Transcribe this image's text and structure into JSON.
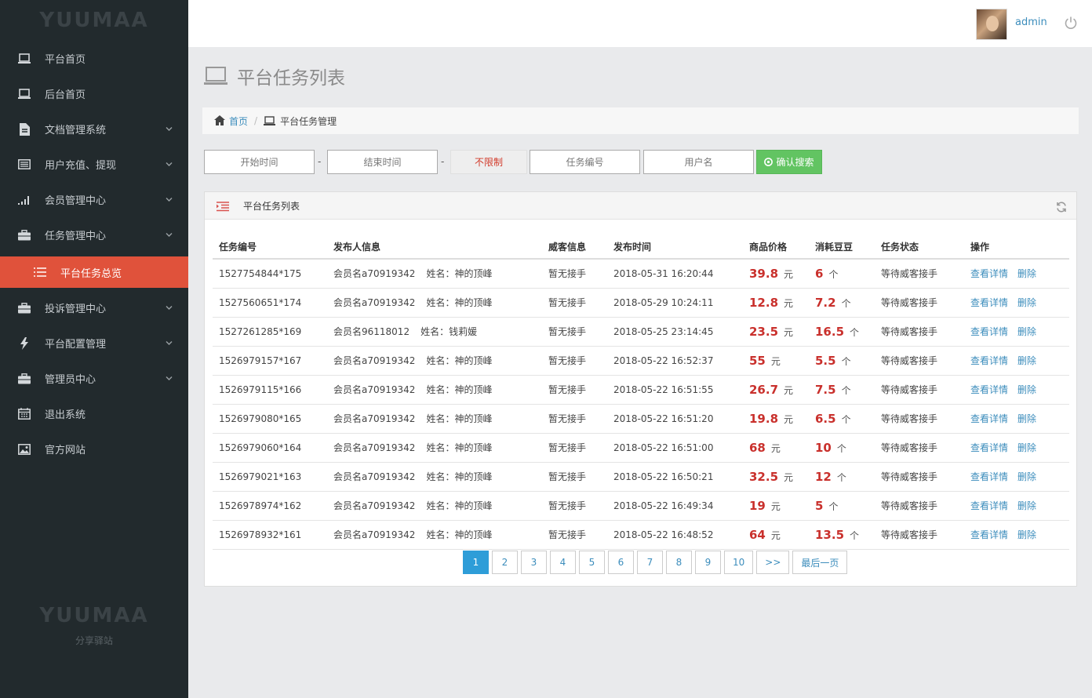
{
  "sidebar": {
    "logo": "YUUMAA",
    "items": [
      {
        "label": "平台首页"
      },
      {
        "label": "后台首页"
      },
      {
        "label": "文档管理系统"
      },
      {
        "label": "用户充值、提现"
      },
      {
        "label": "会员管理中心"
      },
      {
        "label": "任务管理中心"
      },
      {
        "label": "平台任务总览"
      },
      {
        "label": "投诉管理中心"
      },
      {
        "label": "平台配置管理"
      },
      {
        "label": "管理员中心"
      },
      {
        "label": "退出系统"
      },
      {
        "label": "官方网站"
      }
    ],
    "footer_logo": "YUUMAA",
    "footer_sub": "分享驿站"
  },
  "topbar": {
    "username": "admin"
  },
  "page": {
    "title": "平台任务列表"
  },
  "breadcrumb": {
    "home": "首页",
    "current": "平台任务管理"
  },
  "filters": {
    "start_placeholder": "开始时间",
    "end_placeholder": "结束时间",
    "dash": "-",
    "limit": "不限制",
    "task_no_placeholder": "任务编号",
    "username_placeholder": "用户名",
    "search_label": "确认搜索"
  },
  "panel": {
    "title": "平台任务列表"
  },
  "table": {
    "headers": [
      "任务编号",
      "发布人信息",
      "威客信息",
      "发布时间",
      "商品价格",
      "消耗豆豆",
      "任务状态",
      "操作"
    ],
    "price_unit": "元",
    "beans_unit": "个",
    "view_label": "查看详情",
    "delete_label": "删除",
    "rows": [
      {
        "id": "1527754844*175",
        "member": "会员名a70919342",
        "name": "姓名：神的顶峰",
        "worker": "暂无接手",
        "time": "2018-05-31 16:20:44",
        "price": "39.8",
        "beans": "6",
        "status": "等待威客接手"
      },
      {
        "id": "1527560651*174",
        "member": "会员名a70919342",
        "name": "姓名：神的顶峰",
        "worker": "暂无接手",
        "time": "2018-05-29 10:24:11",
        "price": "12.8",
        "beans": "7.2",
        "status": "等待威客接手"
      },
      {
        "id": "1527261285*169",
        "member": "会员名96118012",
        "name": "姓名：钱莉媛",
        "worker": "暂无接手",
        "time": "2018-05-25 23:14:45",
        "price": "23.5",
        "beans": "16.5",
        "status": "等待威客接手"
      },
      {
        "id": "1526979157*167",
        "member": "会员名a70919342",
        "name": "姓名：神的顶峰",
        "worker": "暂无接手",
        "time": "2018-05-22 16:52:37",
        "price": "55",
        "beans": "5.5",
        "status": "等待威客接手"
      },
      {
        "id": "1526979115*166",
        "member": "会员名a70919342",
        "name": "姓名：神的顶峰",
        "worker": "暂无接手",
        "time": "2018-05-22 16:51:55",
        "price": "26.7",
        "beans": "7.5",
        "status": "等待威客接手"
      },
      {
        "id": "1526979080*165",
        "member": "会员名a70919342",
        "name": "姓名：神的顶峰",
        "worker": "暂无接手",
        "time": "2018-05-22 16:51:20",
        "price": "19.8",
        "beans": "6.5",
        "status": "等待威客接手"
      },
      {
        "id": "1526979060*164",
        "member": "会员名a70919342",
        "name": "姓名：神的顶峰",
        "worker": "暂无接手",
        "time": "2018-05-22 16:51:00",
        "price": "68",
        "beans": "10",
        "status": "等待威客接手"
      },
      {
        "id": "1526979021*163",
        "member": "会员名a70919342",
        "name": "姓名：神的顶峰",
        "worker": "暂无接手",
        "time": "2018-05-22 16:50:21",
        "price": "32.5",
        "beans": "12",
        "status": "等待威客接手"
      },
      {
        "id": "1526978974*162",
        "member": "会员名a70919342",
        "name": "姓名：神的顶峰",
        "worker": "暂无接手",
        "time": "2018-05-22 16:49:34",
        "price": "19",
        "beans": "5",
        "status": "等待威客接手"
      },
      {
        "id": "1526978932*161",
        "member": "会员名a70919342",
        "name": "姓名：神的顶峰",
        "worker": "暂无接手",
        "time": "2018-05-22 16:48:52",
        "price": "64",
        "beans": "13.5",
        "status": "等待威客接手"
      }
    ]
  },
  "pagination": {
    "pages": [
      "1",
      "2",
      "3",
      "4",
      "5",
      "6",
      "7",
      "8",
      "9",
      "10"
    ],
    "current": "1",
    "next": ">>",
    "last": "最后一页"
  },
  "colors": {
    "sidebar_bg": "#222a2d",
    "active_item": "#e0523b",
    "link": "#3c8dbc",
    "price": "#c9302c",
    "search_btn": "#62c462",
    "page_active": "#2e9dd8"
  }
}
